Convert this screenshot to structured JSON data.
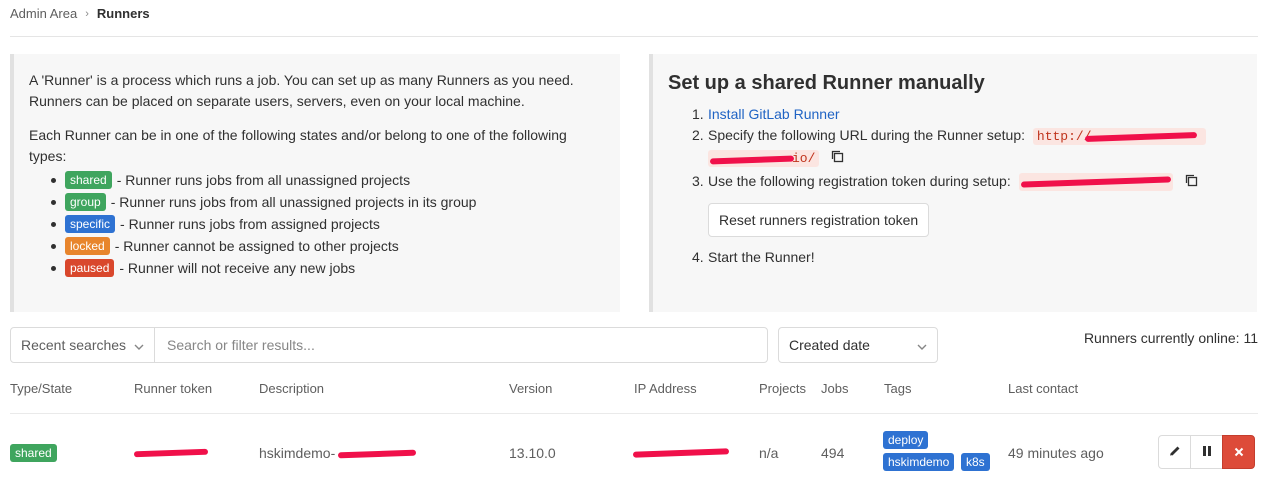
{
  "breadcrumb": {
    "parent": "Admin Area",
    "separator": "›",
    "current": "Runners"
  },
  "intro": {
    "para1": "A 'Runner' is a process which runs a job. You can set up as many Runners as you need. Runners can be placed on separate users, servers, even on your local machine.",
    "para2": "Each Runner can be in one of the following states and/or belong to one of the following types:",
    "states": [
      {
        "badge": "shared",
        "color": "#3fa55e",
        "text": "- Runner runs jobs from all unassigned projects"
      },
      {
        "badge": "group",
        "color": "#3fa55e",
        "text": "- Runner runs jobs from all unassigned projects in its group"
      },
      {
        "badge": "specific",
        "color": "#2e72d2",
        "text": "- Runner runs jobs from assigned projects"
      },
      {
        "badge": "locked",
        "color": "#e8852c",
        "text": "- Runner cannot be assigned to other projects"
      },
      {
        "badge": "paused",
        "color": "#d9472c",
        "text": "- Runner will not receive any new jobs"
      }
    ]
  },
  "setup": {
    "title": "Set up a shared Runner manually",
    "step1_num": "1.",
    "step1_link": "Install GitLab Runner",
    "step2_num": "2.",
    "step2_text": "Specify the following URL during the Runner setup:",
    "step2_url_line1": "http://",
    "step2_url_line2": "io/",
    "step3_num": "3.",
    "step3_text": "Use the following registration token during setup:",
    "reset_button": "Reset runners registration token",
    "step4_num": "4.",
    "step4_text": "Start the Runner!"
  },
  "filter": {
    "recent_label": "Recent searches",
    "search_placeholder": "Search or filter results...",
    "sort_label": "Created date",
    "online_text": "Runners currently online: 11"
  },
  "table": {
    "headers": [
      "Type/State",
      "Runner token",
      "Description",
      "Version",
      "IP Address",
      "Projects",
      "Jobs",
      "Tags",
      "Last contact"
    ],
    "rows": [
      {
        "type": "shared",
        "description": "hskimdemo-",
        "version": "13.10.0",
        "projects": "n/a",
        "jobs": "494",
        "tags": [
          "deploy",
          "hskimdemo",
          "k8s"
        ],
        "last_contact": "49 minutes ago"
      }
    ]
  },
  "colors": {
    "link": "#1f63c4",
    "tag": "#2e72d2",
    "remove": "#dd4b39",
    "redaction": "#f0104a"
  },
  "icons": [
    "chevron-right-icon",
    "copy-icon",
    "chevron-down-icon",
    "pencil-icon",
    "pause-icon",
    "close-icon"
  ]
}
